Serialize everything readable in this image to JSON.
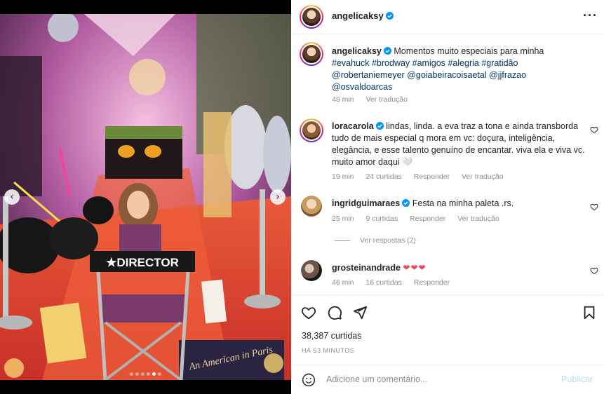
{
  "post": {
    "author": "angelicaksy",
    "caption_text": "Momentos muito especiais para minha",
    "caption_tags_line1": "#evahuck #brodway #amigos #alegria #gratidão",
    "caption_tags_line2": "@robertaniemeyer @goiabeiracoisaetal @jjfrazao",
    "caption_tags_line3": "@osvaldoarcas",
    "caption_time": "48 min",
    "caption_translate": "Ver tradução",
    "likes": "38,387 curtidas",
    "posted_ago": "HÁ 53 MINUTOS"
  },
  "media": {
    "chair_text": "★DIRECTOR",
    "ticket_text": "An American in Paris",
    "prev_icon": "chevron-left-icon",
    "next_icon": "chevron-right-icon",
    "dot_count": 6,
    "active_dot": 4
  },
  "comments": [
    {
      "user": "loracarola",
      "text": "lindas, linda. a eva traz a tona e ainda transborda tudo de mais especial q mora em vc: doçura, inteligência, elegância, e esse talento genuíno de encantar. viva ela e viva vc. muito amor daqui 🤍",
      "time": "19 min",
      "likes": "24 curtidas",
      "reply": "Responder",
      "translate": "Ver tradução"
    },
    {
      "user": "ingridguimaraes",
      "text": "Festa na minha paleta .rs.",
      "time": "25 min",
      "likes": "9 curtidas",
      "reply": "Responder",
      "translate": "Ver tradução"
    },
    {
      "user": "grosteinandrade",
      "text": "❤❤❤",
      "time": "46 min",
      "likes": "16 curtidas",
      "reply": "Responder"
    }
  ],
  "view_replies": "Ver respostas (2)",
  "compose": {
    "placeholder": "Adicione um comentário...",
    "post_label": "Publicar"
  },
  "colors": {
    "link": "#00376b",
    "muted": "#8e8e8e",
    "verified": "#0095f6",
    "like_red": "#ed4956",
    "publish_disabled": "#b2dffc"
  }
}
